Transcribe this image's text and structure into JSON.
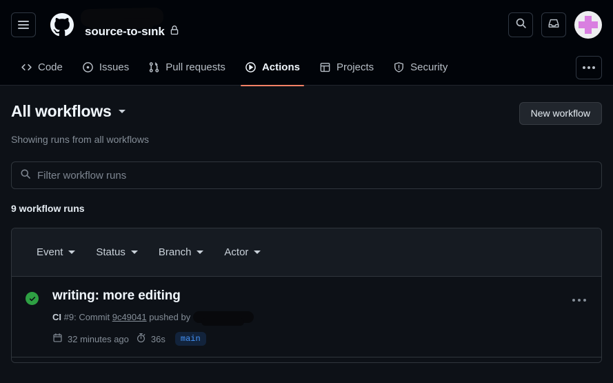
{
  "colors": {
    "page_bg": "#0d1117",
    "appbar_bg": "#010409",
    "accent_active_tab": "#f78166",
    "success_green": "#2ea043",
    "branch_blue": "#4493f8",
    "avatar_pink": "#d97fe0"
  },
  "appbar": {
    "menu_icon": "hamburger-menu-icon",
    "logo_icon": "github-logo-icon",
    "owner_name": "",
    "owner_redacted": true,
    "repo_name": "source-to-sink",
    "visibility_icon": "lock-icon",
    "search_icon": "search-icon",
    "inbox_icon": "inbox-icon",
    "avatar_label": "user-avatar"
  },
  "reponav": {
    "tabs": [
      {
        "label": "Code",
        "icon": "code-icon",
        "active": false
      },
      {
        "label": "Issues",
        "icon": "issue-opened-icon",
        "active": false
      },
      {
        "label": "Pull requests",
        "icon": "git-pull-request-icon",
        "active": false
      },
      {
        "label": "Actions",
        "icon": "play-icon",
        "active": true
      },
      {
        "label": "Projects",
        "icon": "table-icon",
        "active": false
      },
      {
        "label": "Security",
        "icon": "shield-icon",
        "active": false
      }
    ],
    "overflow_icon": "kebab-horizontal-icon"
  },
  "main": {
    "heading": "All workflows",
    "heading_caret": "chevron-down-icon",
    "subtitle": "Showing runs from all workflows",
    "new_workflow_label": "New workflow",
    "search": {
      "icon": "search-icon",
      "value": "",
      "placeholder": "Filter workflow runs"
    },
    "runs_count_label": "9 workflow runs",
    "filters": [
      {
        "label": "Event"
      },
      {
        "label": "Status"
      },
      {
        "label": "Branch"
      },
      {
        "label": "Actor"
      }
    ],
    "runs": [
      {
        "status_icon": "check-circle-fill-icon",
        "status": "success",
        "title": "writing: more editing",
        "workflow_name": "CI",
        "run_number": "#9",
        "meta_prefix": ": Commit",
        "commit_sha": "9c49041",
        "meta_suffix": "pushed by",
        "actor_redacted": true,
        "time_icon": "calendar-icon",
        "time_ago": "32 minutes ago",
        "duration_icon": "stopwatch-icon",
        "duration": "36s",
        "branch": "main",
        "row_menu_icon": "kebab-horizontal-icon"
      }
    ]
  }
}
